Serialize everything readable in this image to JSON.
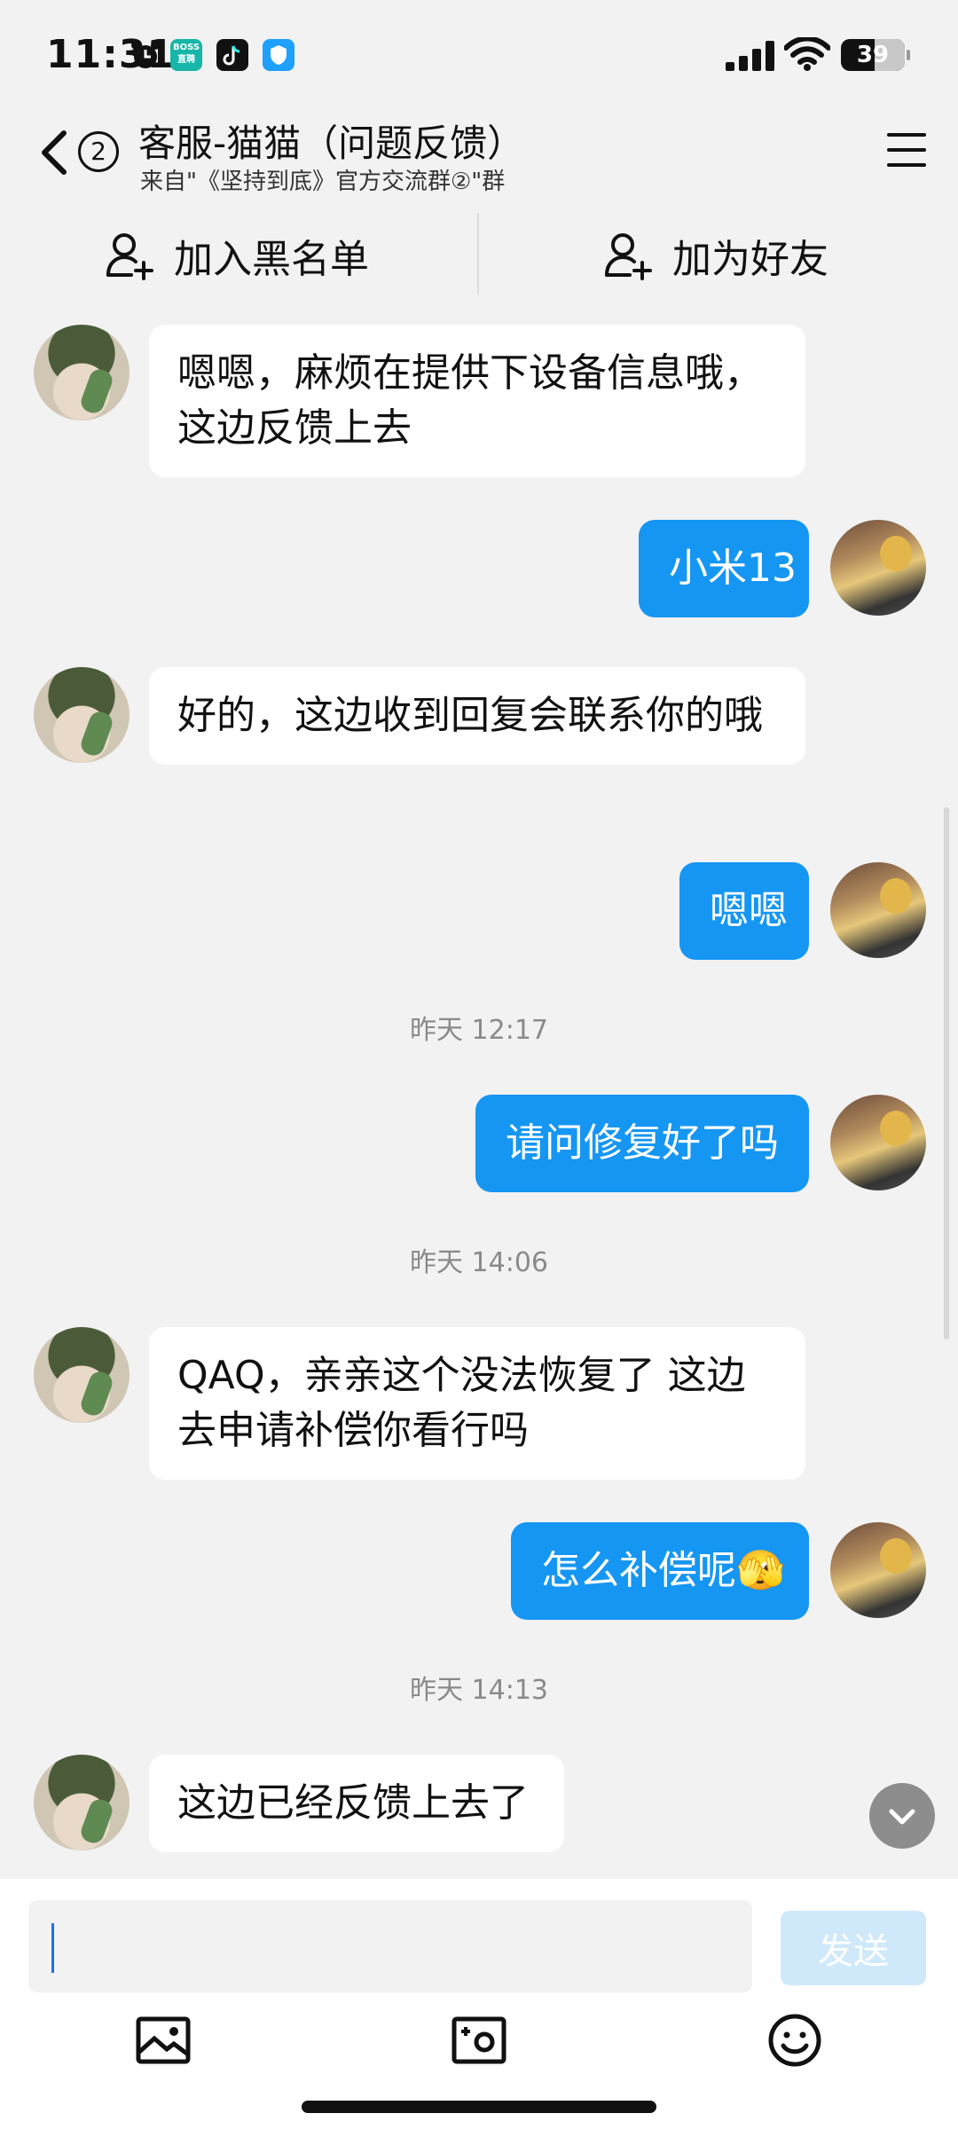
{
  "status": {
    "time": "11:31",
    "battery": "39",
    "boss_badge": "BOSS\n直聘"
  },
  "header": {
    "unread_count": "2",
    "title": "客服-猫猫（问题反馈）",
    "subtitle": "来自\"《坚持到底》官方交流群②\"群"
  },
  "actions": {
    "blacklist_label": "加入黑名单",
    "add_friend_label": "加为好友"
  },
  "messages": [
    {
      "side": "in",
      "text": "嗯嗯，麻烦在提供下设备信息哦，这边反馈上去"
    },
    {
      "side": "out",
      "text": "小米13"
    },
    {
      "side": "in",
      "text": "好的，这边收到回复会联系你的哦"
    },
    {
      "side": "out",
      "text": "嗯嗯"
    },
    {
      "timestamp": "昨天 12:17"
    },
    {
      "side": "out",
      "text": "请问修复好了吗"
    },
    {
      "timestamp": "昨天 14:06"
    },
    {
      "side": "in",
      "text": "QAQ，亲亲这个没法恢复了 这边去申请补偿你看行吗"
    },
    {
      "side": "out",
      "text": "怎么补偿呢🫣"
    },
    {
      "timestamp": "昨天 14:13"
    },
    {
      "side": "in",
      "text": "这边已经反馈上去了"
    }
  ],
  "composer": {
    "value": "",
    "send_label": "发送"
  },
  "colors": {
    "accent": "#1596f3",
    "send_disabled": "#cfe9fb",
    "background": "#f2f2f2"
  },
  "icons": {
    "back": "chevron-left-icon",
    "menu": "hamburger-icon",
    "add_person": "person-plus-icon",
    "image": "image-icon",
    "camera": "camera-icon",
    "emoji": "smile-icon",
    "scroll_down": "chevron-down-icon"
  }
}
